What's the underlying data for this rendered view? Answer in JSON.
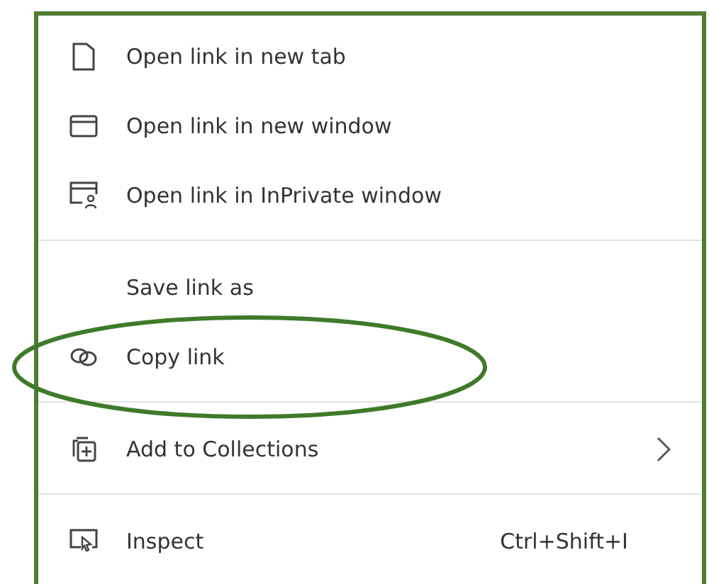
{
  "menu": {
    "sections": [
      {
        "items": [
          {
            "label": "Open link in new tab",
            "annotated": false
          },
          {
            "label": "Open link in new window",
            "annotated": false
          },
          {
            "label": "Open link in InPrivate window",
            "annotated": false
          }
        ]
      },
      {
        "items": [
          {
            "label": "Save link as",
            "annotated": false
          },
          {
            "label": "Copy link",
            "annotated": true
          }
        ]
      },
      {
        "items": [
          {
            "label": "Add to Collections",
            "submenu": true,
            "annotated": false
          }
        ]
      },
      {
        "items": [
          {
            "label": "Inspect",
            "shortcut": "Ctrl+Shift+I",
            "annotated": false
          }
        ]
      }
    ]
  }
}
